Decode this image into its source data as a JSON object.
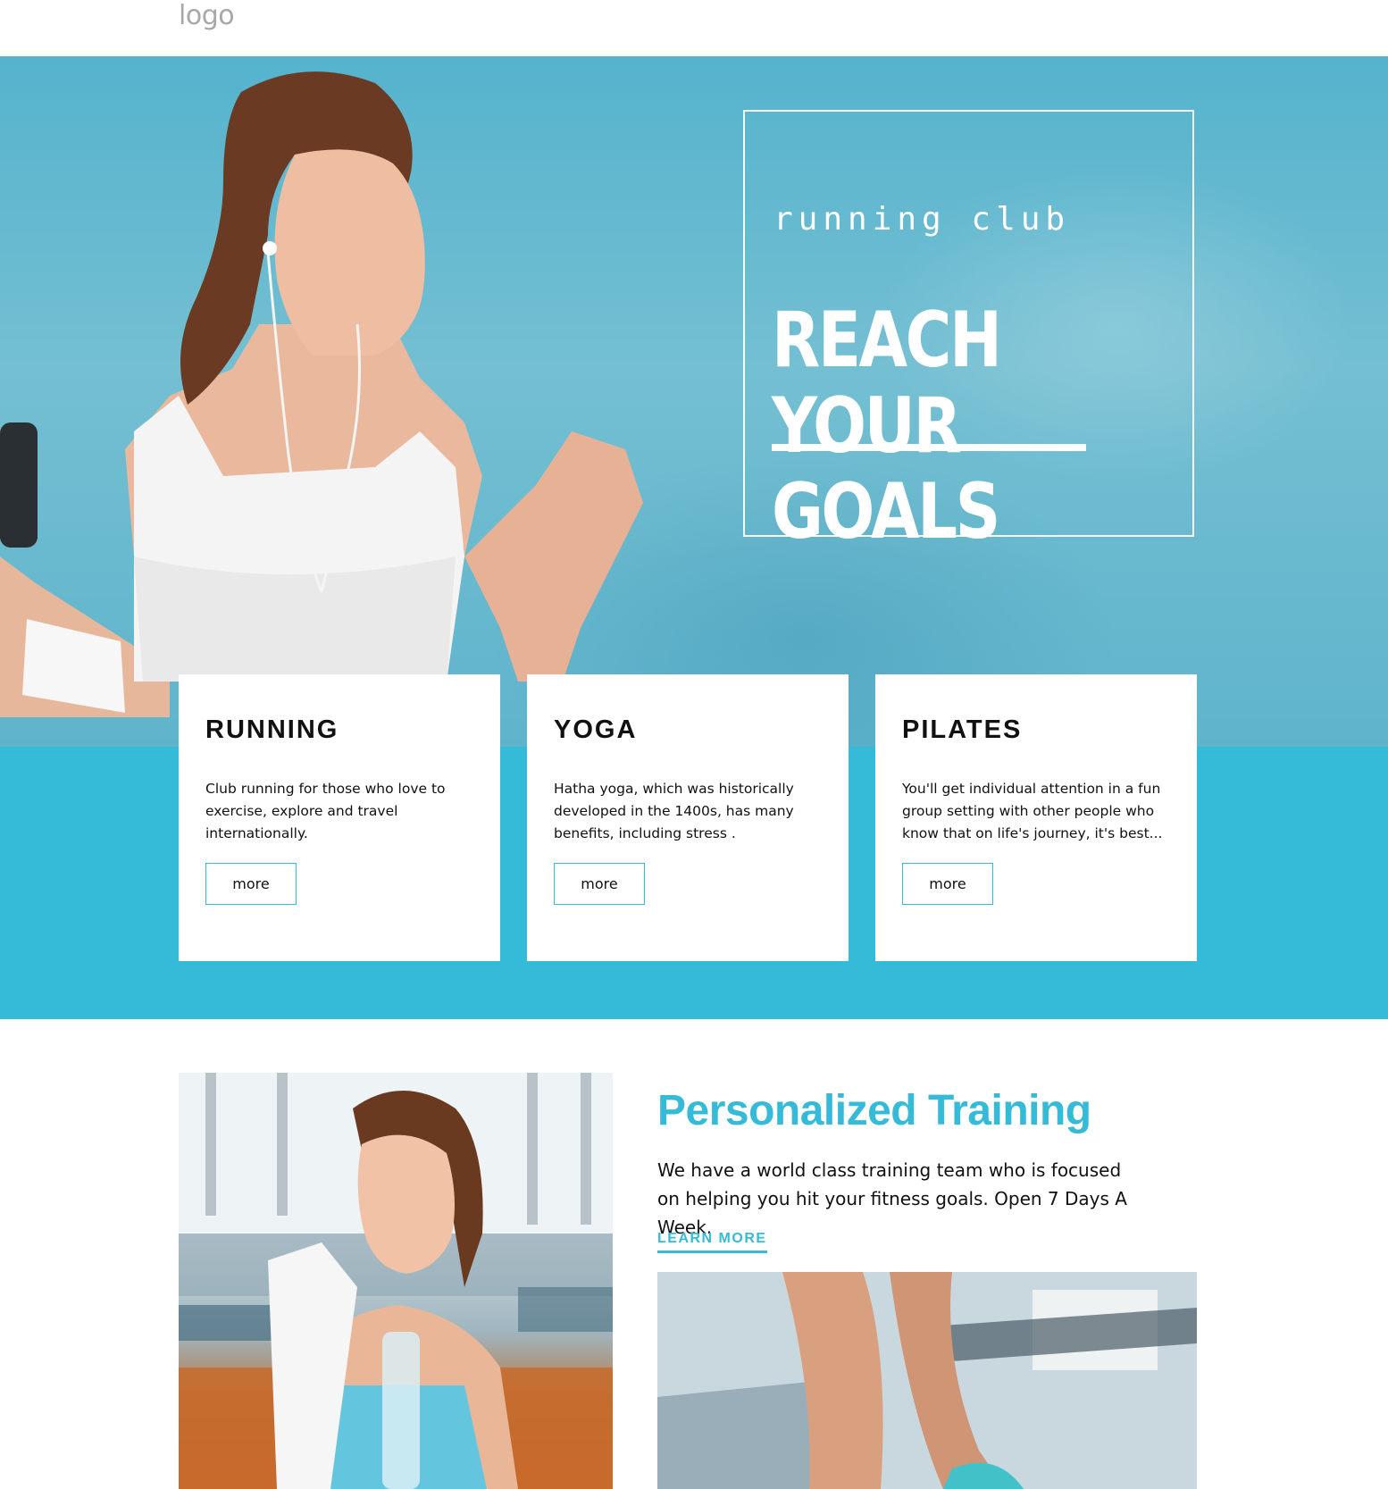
{
  "header": {
    "logo_text": "logo"
  },
  "hero": {
    "kicker": "running club",
    "title": "REACH YOUR GOALS"
  },
  "cards": [
    {
      "title": "RUNNING",
      "text": "Club running for those who love to exercise, explore and travel internationally.",
      "button": "more"
    },
    {
      "title": "YOGA",
      "text": "Hatha yoga, which was historically developed in the 1400s, has many benefits, including stress .",
      "button": "more"
    },
    {
      "title": "PILATES",
      "text": "You'll get individual attention in a fun group setting with other people who know that on life's journey, it's best...",
      "button": "more"
    }
  ],
  "training": {
    "title": "Personalized Training",
    "text": "We have a world class training team who is focused on helping you hit your fitness goals. Open 7 Days A Week.",
    "link": "LEARN MORE"
  },
  "colors": {
    "accent": "#35bbd8",
    "hero_sky": "#5fb4cc",
    "text": "#111111"
  }
}
